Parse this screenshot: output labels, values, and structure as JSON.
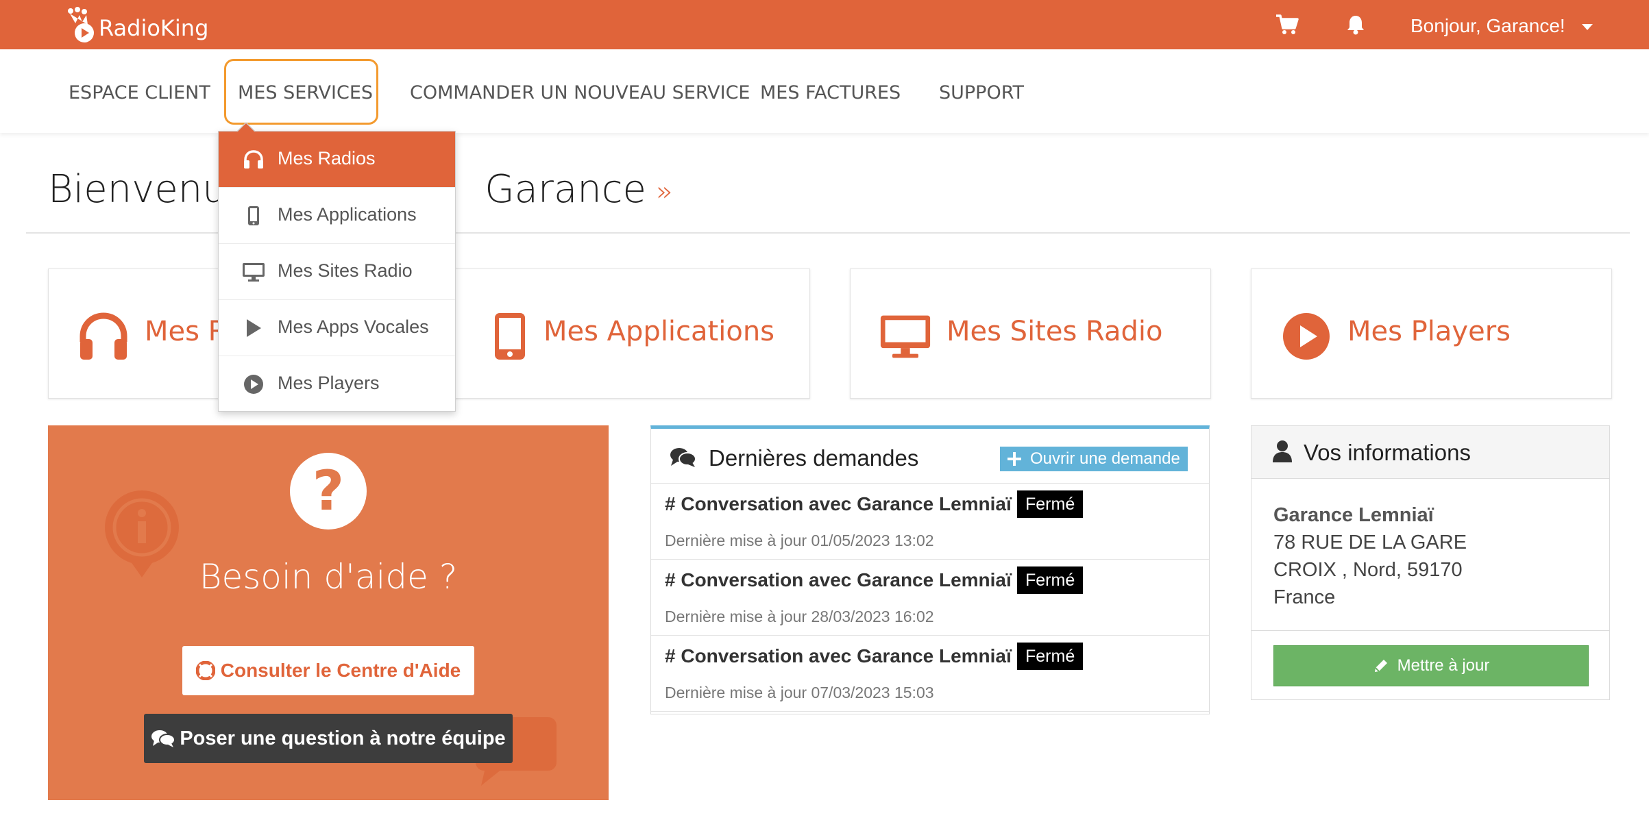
{
  "brand": {
    "name": "RadioKing",
    "accent": "#e0643a"
  },
  "topbar": {
    "cart_icon": "cart-icon",
    "bell_icon": "bell-icon",
    "greeting": "Bonjour, Garance!"
  },
  "nav": {
    "items": [
      {
        "label": "ESPACE CLIENT"
      },
      {
        "label": "MES SERVICES",
        "active": true
      },
      {
        "label": "COMMANDER UN NOUVEAU SERVICE"
      },
      {
        "label": "MES FACTURES"
      },
      {
        "label": "SUPPORT"
      }
    ]
  },
  "dropdown": {
    "items": [
      {
        "label": "Mes Radios",
        "icon": "headphones-icon",
        "active": true
      },
      {
        "label": "Mes Applications",
        "icon": "mobile-icon"
      },
      {
        "label": "Mes Sites Radio",
        "icon": "desktop-icon"
      },
      {
        "label": "Mes Apps Vocales",
        "icon": "play-icon"
      },
      {
        "label": "Mes Players",
        "icon": "play-circle-icon"
      }
    ]
  },
  "page": {
    "title_visible_left": "Bienvenue",
    "title_visible_right": "Garance",
    "title_suffix": "»"
  },
  "cards": [
    {
      "label": "Mes Radios",
      "visible_label": "Mes R",
      "icon": "headphones-icon"
    },
    {
      "label": "Mes Applications",
      "icon": "mobile-icon"
    },
    {
      "label": "Mes Sites Radio",
      "icon": "desktop-icon"
    },
    {
      "label": "Mes Players",
      "icon": "play-circle-icon"
    }
  ],
  "help": {
    "title": "Besoin d'aide ?",
    "help_center_button": "Consulter le Centre d'Aide",
    "ask_team_button": "Poser une question à notre équipe"
  },
  "requests": {
    "title": "Dernières demandes",
    "open_button": "Ouvrir une demande",
    "rows": [
      {
        "title": "# Conversation avec Garance Lemniaï",
        "status": "Fermé",
        "updated": "Dernière mise à jour 01/05/2023 13:02"
      },
      {
        "title": "# Conversation avec Garance Lemniaï",
        "status": "Fermé",
        "updated": "Dernière mise à jour 28/03/2023 16:02"
      },
      {
        "title": "# Conversation avec Garance Lemniaï",
        "status": "Fermé",
        "updated": "Dernière mise à jour 07/03/2023 15:03"
      }
    ]
  },
  "info": {
    "title": "Vos informations",
    "name": "Garance Lemniaï",
    "address_line1": "78 RUE DE LA GARE",
    "address_line2": "CROIX , Nord, 59170",
    "country": "France",
    "update_button": "Mettre à jour"
  }
}
